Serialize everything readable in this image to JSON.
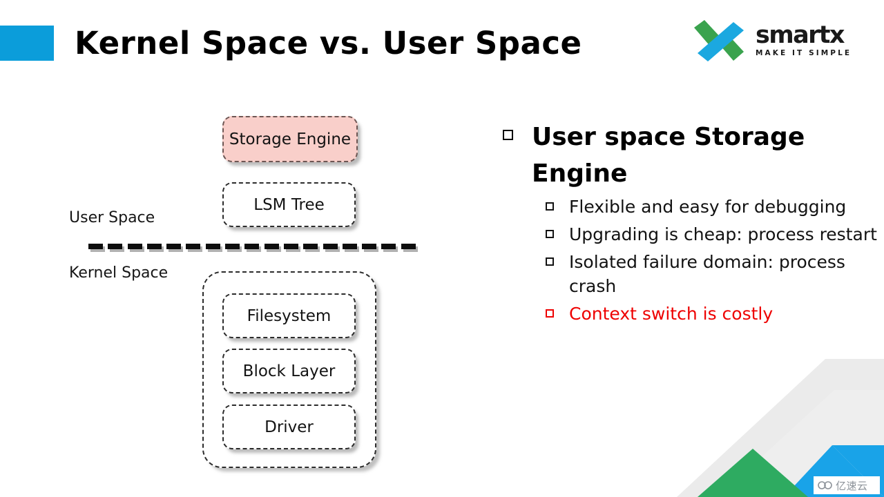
{
  "header": {
    "title": "Kernel Space vs. User Space",
    "accent_color": "#0b9dda"
  },
  "logo": {
    "name": "smartx",
    "tagline": "MAKE IT SIMPLE",
    "mark_green": "#3aa34e",
    "mark_blue": "#1ba8e0"
  },
  "diagram": {
    "user_space_label": "User Space",
    "kernel_space_label": "Kernel Space",
    "user_boxes": [
      {
        "label": "Storage Engine",
        "fill": "#f9cfca",
        "highlight": true
      },
      {
        "label": "LSM Tree",
        "fill": "#ffffff",
        "highlight": false
      }
    ],
    "kernel_boxes": [
      {
        "label": "Filesystem"
      },
      {
        "label": "Block Layer"
      },
      {
        "label": "Driver"
      }
    ],
    "divider_dash_count": 17
  },
  "bullets": {
    "main": "User space Storage Engine",
    "sub": [
      {
        "text": "Flexible and easy for debugging",
        "color": "#121212"
      },
      {
        "text": "Upgrading is cheap: process restart",
        "color": "#121212"
      },
      {
        "text": "Isolated failure domain: process crash",
        "color": "#121212"
      },
      {
        "text": "Context switch is costly",
        "color": "#ee0000"
      }
    ]
  },
  "watermark": {
    "text": "亿速云"
  }
}
